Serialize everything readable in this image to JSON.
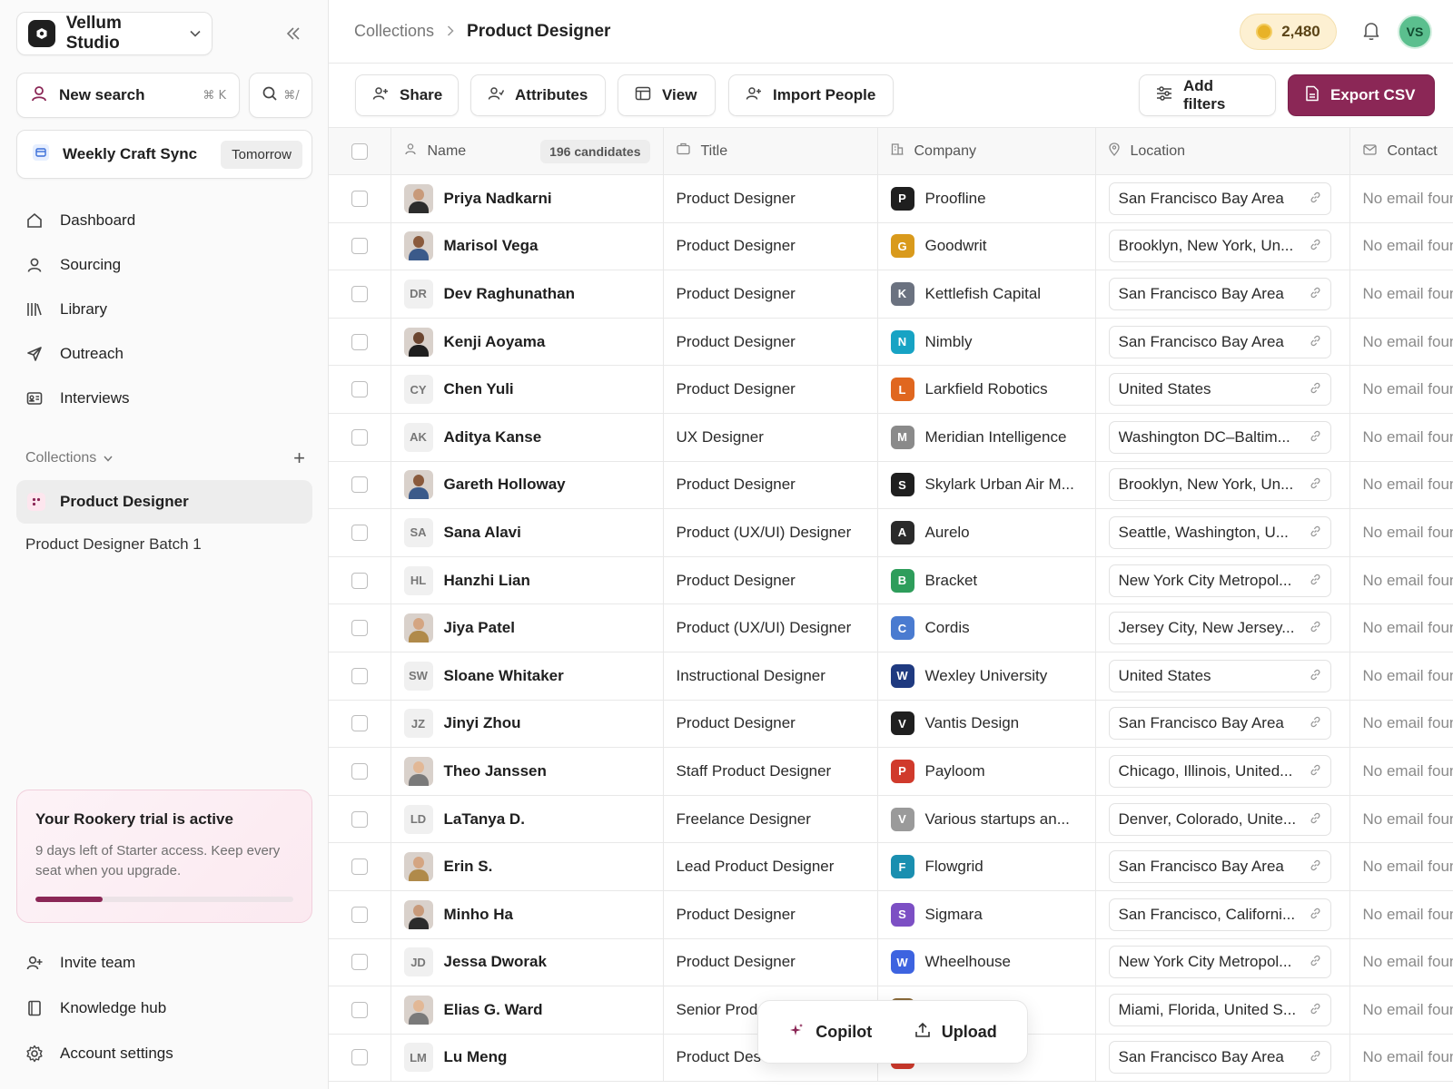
{
  "workspace": {
    "name": "Vellum Studio"
  },
  "new_search": {
    "label": "New search",
    "shortcut": "⌘ K"
  },
  "search": {
    "shortcut": "⌘/"
  },
  "meeting": {
    "title": "Weekly Craft Sync",
    "badge": "Tomorrow"
  },
  "nav": [
    {
      "label": "Dashboard",
      "icon": "home-icon"
    },
    {
      "label": "Sourcing",
      "icon": "person-icon"
    },
    {
      "label": "Library",
      "icon": "library-icon"
    },
    {
      "label": "Outreach",
      "icon": "send-icon"
    },
    {
      "label": "Interviews",
      "icon": "id-card-icon"
    }
  ],
  "collections": {
    "header": "Collections",
    "active": "Product Designer",
    "items": [
      "Product Designer Batch 1"
    ]
  },
  "trial": {
    "title": "Your Rookery trial is active",
    "desc": "9 days left of Starter access. Keep every seat when you upgrade.",
    "progress": 0.26,
    "color": "#8b2756"
  },
  "bottom_nav": [
    {
      "label": "Invite team",
      "icon": "invite-icon"
    },
    {
      "label": "Knowledge hub",
      "icon": "book-icon"
    },
    {
      "label": "Account settings",
      "icon": "gear-icon"
    }
  ],
  "breadcrumb": {
    "parent": "Collections",
    "current": "Product Designer"
  },
  "credits": "2,480",
  "user_initials": "VS",
  "toolbar": {
    "share": "Share",
    "attributes": "Attributes",
    "view": "View",
    "import": "Import People",
    "filters": "Add filters",
    "export": "Export CSV"
  },
  "table": {
    "headers": {
      "name": "Name",
      "count": "196 candidates",
      "title": "Title",
      "company": "Company",
      "location": "Location",
      "contact": "Contact"
    },
    "rows": [
      {
        "name": "Priya Nadkarni",
        "avatar": "photo",
        "title": "Product Designer",
        "company": "Proofline",
        "logo": "P",
        "logo_color": "#1f1f1f",
        "location": "San Francisco Bay Area",
        "contact": "No email found"
      },
      {
        "name": "Marisol Vega",
        "avatar": "photo",
        "title": "Product Designer",
        "company": "Goodwrit",
        "logo": "G",
        "logo_color": "#d99a1c",
        "location": "Brooklyn, New York, Un...",
        "contact": "No email found"
      },
      {
        "name": "Dev Raghunathan",
        "avatar": "DR",
        "title": "Product Designer",
        "company": "Kettlefish Capital",
        "logo": "K",
        "logo_color": "#6b7280",
        "location": "San Francisco Bay Area",
        "contact": "No email found"
      },
      {
        "name": "Kenji Aoyama",
        "avatar": "photo",
        "title": "Product Designer",
        "company": "Nimbly",
        "logo": "N",
        "logo_color": "#17a3c4",
        "location": "San Francisco Bay Area",
        "contact": "No email found"
      },
      {
        "name": "Chen Yuli",
        "avatar": "CY",
        "title": "Product Designer",
        "company": "Larkfield Robotics",
        "logo": "L",
        "logo_color": "#e0671f",
        "location": "United States",
        "contact": "No email found"
      },
      {
        "name": "Aditya Kanse",
        "avatar": "AK",
        "title": "UX Designer",
        "company": "Meridian Intelligence",
        "logo": "M",
        "logo_color": "#8a8a8a",
        "location": "Washington DC–Baltim...",
        "contact": "No email found"
      },
      {
        "name": "Gareth Holloway",
        "avatar": "photo",
        "title": "Product Designer",
        "company": "Skylark Urban Air M...",
        "logo": "S",
        "logo_color": "#1f1f1f",
        "location": "Brooklyn, New York, Un...",
        "contact": "No email found"
      },
      {
        "name": "Sana Alavi",
        "avatar": "SA",
        "title": "Product (UX/UI) Designer",
        "company": "Aurelo",
        "logo": "A",
        "logo_color": "#2a2a2a",
        "location": "Seattle, Washington, U...",
        "contact": "No email found"
      },
      {
        "name": "Hanzhi Lian",
        "avatar": "HL",
        "title": "Product Designer",
        "company": "Bracket",
        "logo": "B",
        "logo_color": "#2e9d5b",
        "location": "New York City Metropol...",
        "contact": "No email found"
      },
      {
        "name": "Jiya Patel",
        "avatar": "photo",
        "title": "Product (UX/UI) Designer",
        "company": "Cordis",
        "logo": "C",
        "logo_color": "#4a7bd0",
        "location": "Jersey City, New Jersey...",
        "contact": "No email found"
      },
      {
        "name": "Sloane Whitaker",
        "avatar": "SW",
        "title": "Instructional Designer",
        "company": "Wexley University",
        "logo": "W",
        "logo_color": "#1f3a80",
        "location": "United States",
        "contact": "No email found"
      },
      {
        "name": "Jinyi Zhou",
        "avatar": "JZ",
        "title": "Product Designer",
        "company": "Vantis Design",
        "logo": "V",
        "logo_color": "#1f1f1f",
        "location": "San Francisco Bay Area",
        "contact": "No email found"
      },
      {
        "name": "Theo Janssen",
        "avatar": "photo",
        "title": "Staff Product Designer",
        "company": "Payloom",
        "logo": "P",
        "logo_color": "#d03a2c",
        "location": "Chicago, Illinois, United...",
        "contact": "No email found"
      },
      {
        "name": "LaTanya D.",
        "avatar": "LD",
        "title": "Freelance Designer",
        "company": "Various startups an...",
        "logo": "V",
        "logo_color": "#9a9a9a",
        "location": "Denver, Colorado, Unite...",
        "contact": "No email found"
      },
      {
        "name": "Erin S.",
        "avatar": "photo",
        "title": "Lead Product Designer",
        "company": "Flowgrid",
        "logo": "F",
        "logo_color": "#1a8fb0",
        "location": "San Francisco Bay Area",
        "contact": "No email found"
      },
      {
        "name": "Minho Ha",
        "avatar": "photo",
        "title": "Product Designer",
        "company": "Sigmara",
        "logo": "S",
        "logo_color": "#7c4fc4",
        "location": "San Francisco, Californi...",
        "contact": "No email found"
      },
      {
        "name": "Jessa Dworak",
        "avatar": "JD",
        "title": "Product Designer",
        "company": "Wheelhouse",
        "logo": "W",
        "logo_color": "#3d63e0",
        "location": "New York City Metropol...",
        "contact": "No email found"
      },
      {
        "name": "Elias G. Ward",
        "avatar": "photo",
        "title": "Senior Prod",
        "company": "",
        "logo": "",
        "logo_color": "#8a6a3a",
        "location": "Miami, Florida, United S...",
        "contact": "No email found"
      },
      {
        "name": "Lu Meng",
        "avatar": "LM",
        "title": "Product Des",
        "company": "",
        "logo": "",
        "logo_color": "#d03a2c",
        "location": "San Francisco Bay Area",
        "contact": "No email found"
      }
    ]
  },
  "floating": {
    "copilot": "Copilot",
    "upload": "Upload"
  }
}
